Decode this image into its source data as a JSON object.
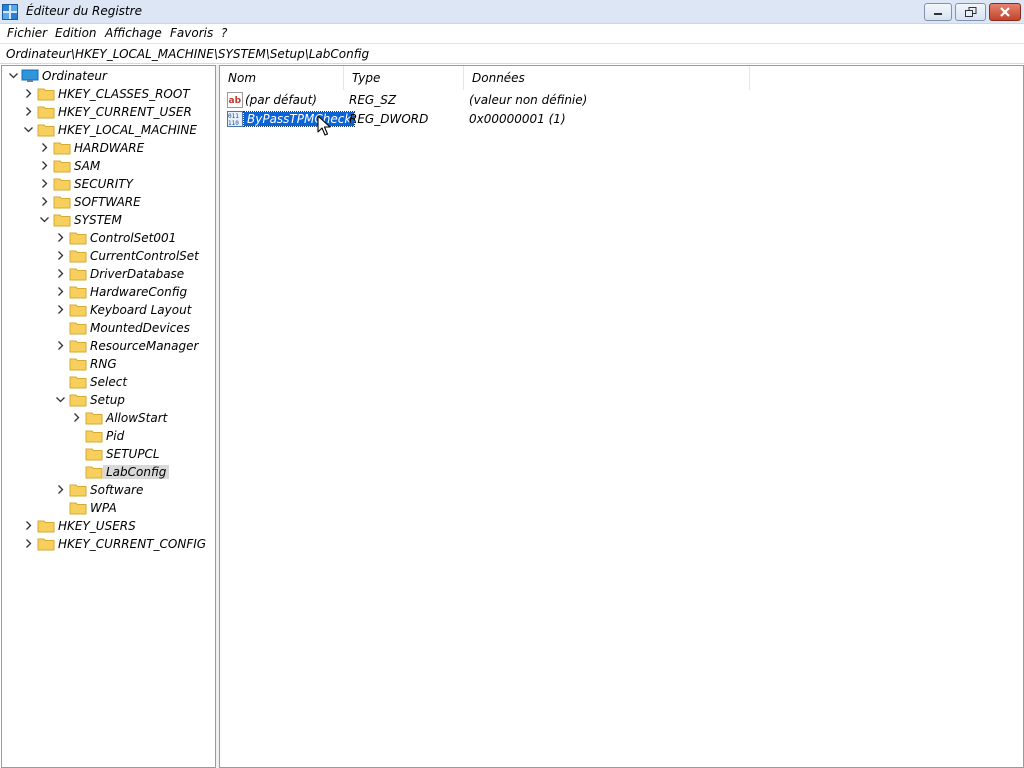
{
  "window": {
    "title": "Éditeur du Registre",
    "icon": "registry-editor-icon",
    "controls": [
      "minimize-icon",
      "restore-icon",
      "close-icon"
    ]
  },
  "menu": {
    "file": "Fichier",
    "edit": "Edition",
    "view": "Affichage",
    "favorites": "Favoris",
    "help": "?"
  },
  "address": {
    "path": "Ordinateur\\HKEY_LOCAL_MACHINE\\SYSTEM\\Setup\\LabConfig"
  },
  "tree": {
    "root": "Ordinateur",
    "hkcr": "HKEY_CLASSES_ROOT",
    "hkcu": "HKEY_CURRENT_USER",
    "hklm": "HKEY_LOCAL_MACHINE",
    "hardware": "HARDWARE",
    "sam": "SAM",
    "security": "SECURITY",
    "software_upper": "SOFTWARE",
    "system": "SYSTEM",
    "controlset001": "ControlSet001",
    "currentcontrolset": "CurrentControlSet",
    "driverdatabase": "DriverDatabase",
    "hardwareconfig": "HardwareConfig",
    "keyboardlayout": "Keyboard Layout",
    "mounteddevices": "MountedDevices",
    "resourcemanager": "ResourceManager",
    "rng": "RNG",
    "select": "Select",
    "setup": "Setup",
    "allowstart": "AllowStart",
    "pid": "Pid",
    "setupcl": "SETUPCL",
    "labconfig": "LabConfig",
    "software": "Software",
    "wpa": "WPA",
    "hku": "HKEY_USERS",
    "hkcc": "HKEY_CURRENT_CONFIG",
    "selected": "LabConfig"
  },
  "values": {
    "columns": {
      "name": "Nom",
      "type": "Type",
      "data": "Données"
    },
    "rows": [
      {
        "name": "(par défaut)",
        "type": "REG_SZ",
        "data": "(valeur non définie)",
        "icon": "string-value-icon"
      },
      {
        "name": "ByPassTPMCheck",
        "type": "REG_DWORD",
        "data": "0x00000001 (1)",
        "icon": "binary-value-icon",
        "selected": true
      }
    ]
  },
  "colors": {
    "titlebar": "#dce6f4",
    "selection": "#0a64d6",
    "folder": "#f6cf5c",
    "close": "#c9482f"
  }
}
